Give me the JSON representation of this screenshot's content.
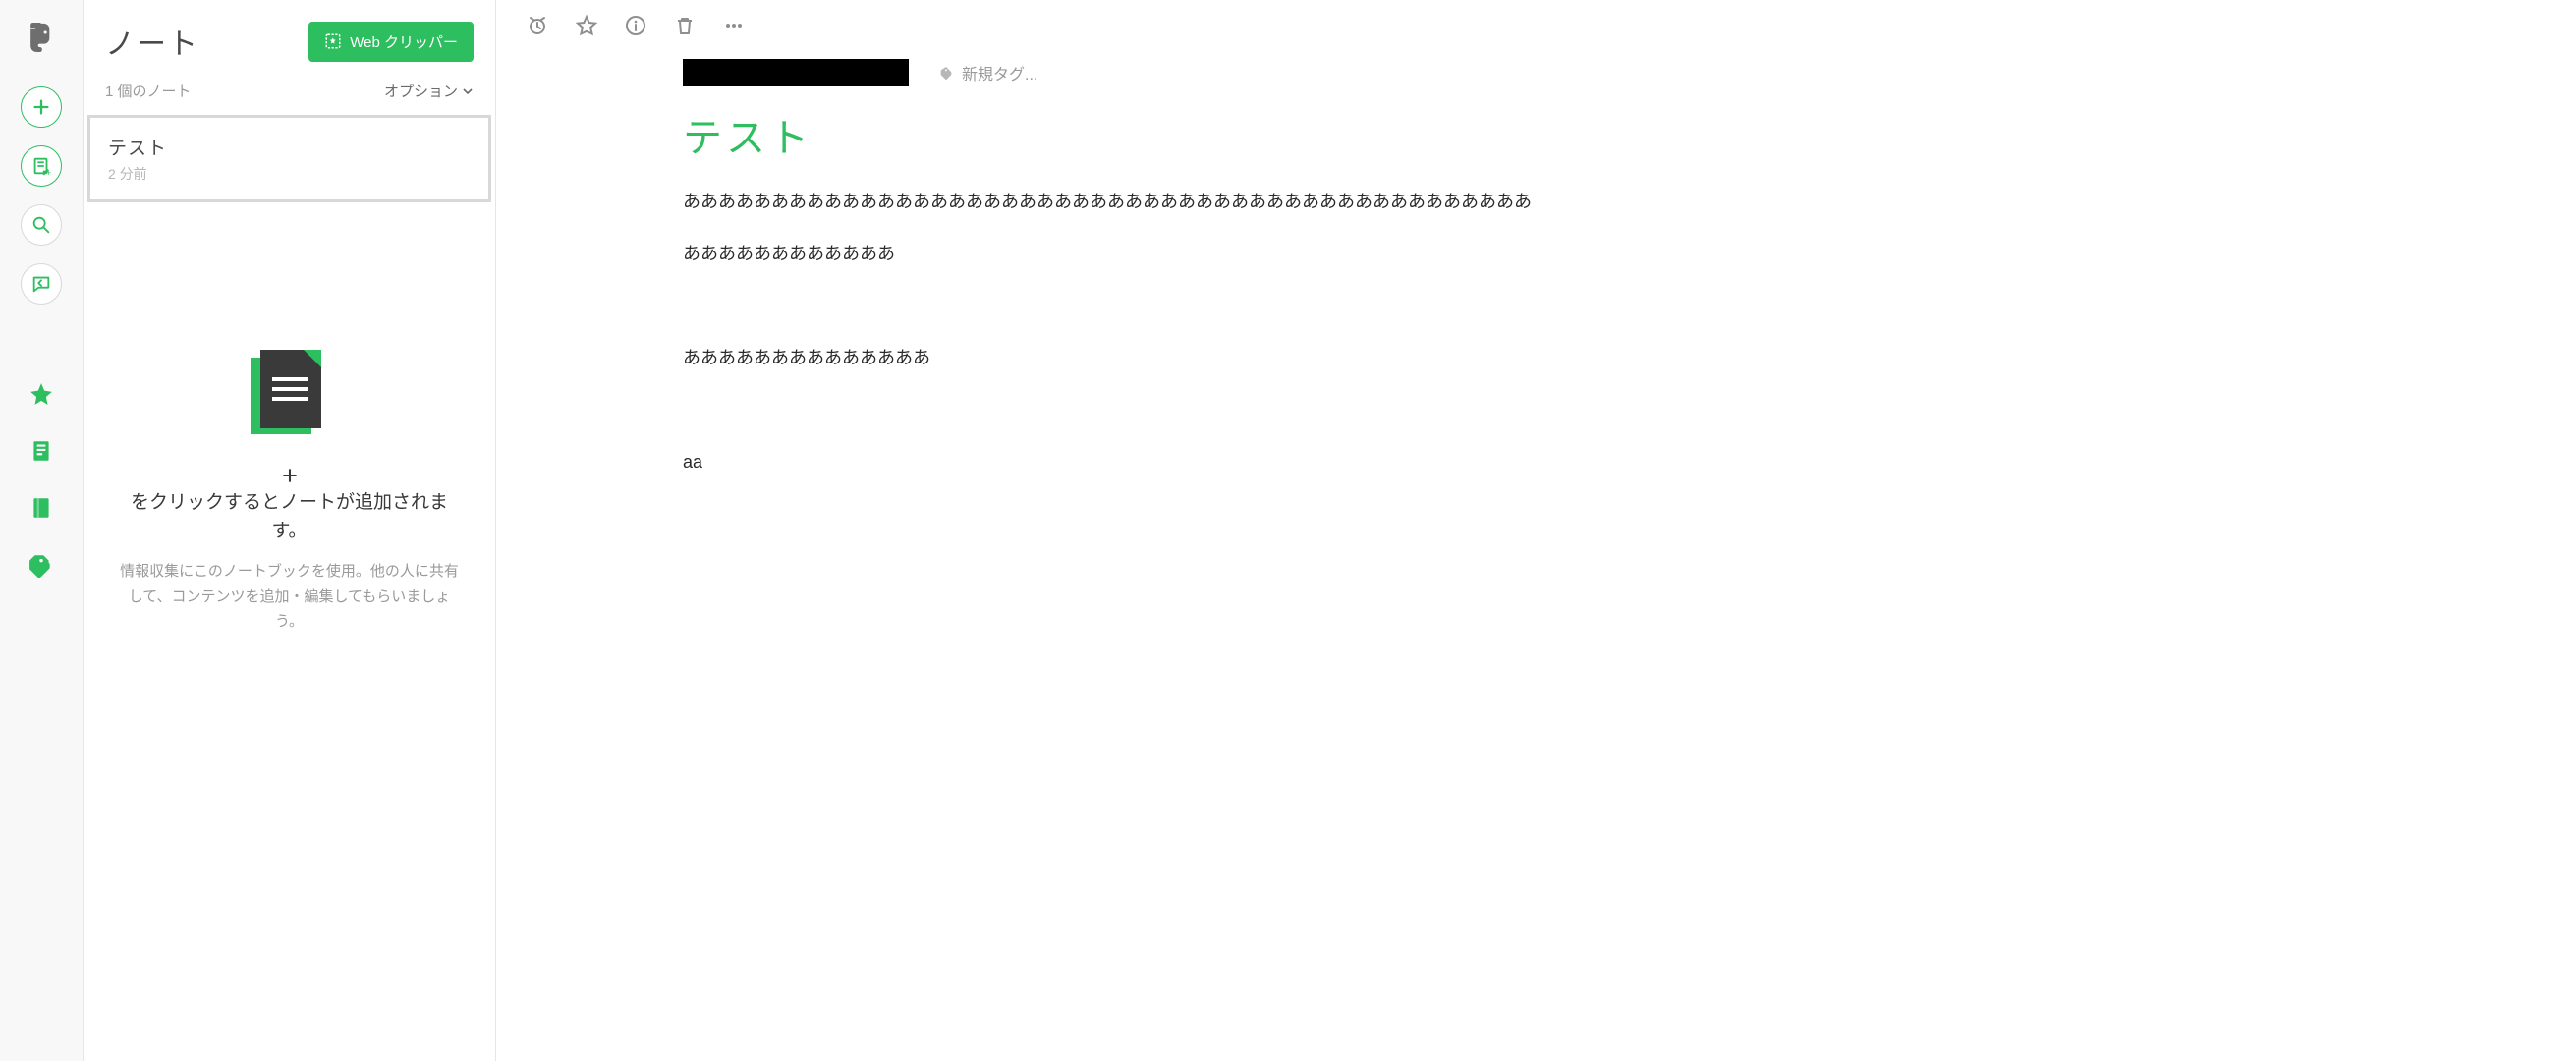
{
  "rail": {
    "logo": "evernote-logo"
  },
  "list": {
    "heading": "ノート",
    "clip_button": "Web クリッパー",
    "count_label": "1 個のノート",
    "options_label": "オプション",
    "notes": [
      {
        "title": "テスト",
        "time": "2 分前"
      }
    ],
    "empty": {
      "heading_prefix": "",
      "heading_text": "をクリックするとノートが追加されます。",
      "body": "情報収集にこのノートブックを使用。他の人に共有して、コンテンツを追加・編集してもらいましょう。"
    }
  },
  "editor": {
    "tag_placeholder": "新規タグ...",
    "title": "テスト",
    "paragraphs": [
      "ああああああああああああああああああああああああああああああああああああああああああああああああ",
      "ああああああああああああ",
      "",
      "ああああああああああああああ",
      "",
      "aa"
    ]
  }
}
